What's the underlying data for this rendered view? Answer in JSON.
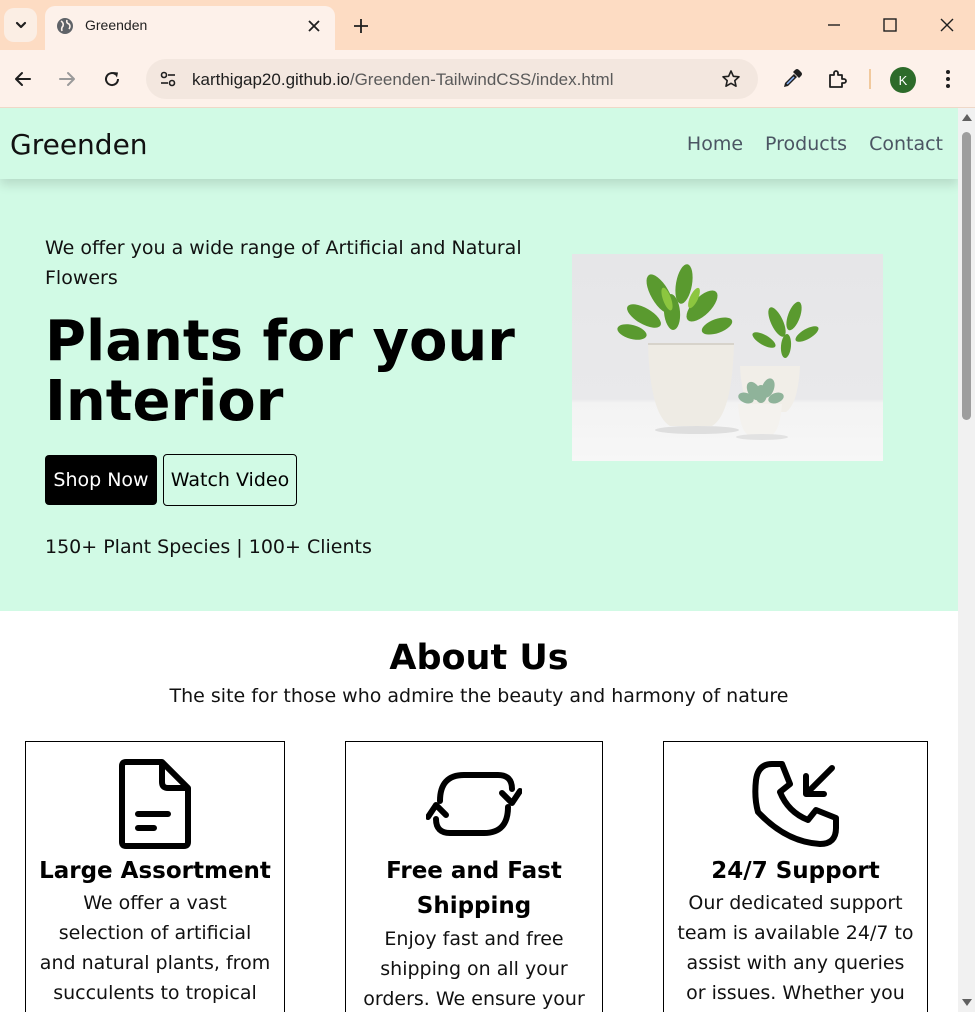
{
  "browser": {
    "tab_title": "Greenden",
    "url_host": "karthigap20.github.io",
    "url_path": "/Greenden-TailwindCSS/index.html",
    "profile_initial": "K",
    "colors": {
      "tabbar": "#fddcc3",
      "toolbar": "#fdf1ea",
      "profile": "#2d6b2a"
    }
  },
  "site": {
    "brand": "Greenden",
    "nav": [
      "Home",
      "Products",
      "Contact"
    ],
    "hero": {
      "subtitle": "We offer you a wide range of Artificial and Natural Flowers",
      "title": "Plants for your Interior",
      "primary_button": "Shop Now",
      "secondary_button": "Watch Video",
      "stats": "150+ Plant Species | 100+ Clients",
      "image_icon": "potted-plants-photo"
    },
    "about": {
      "title": "About Us",
      "subtitle": "The site for those who admire the beauty and harmony of nature",
      "cards": [
        {
          "icon": "document-icon",
          "title": "Large Assortment",
          "text": "We offer a vast selection of artificial and natural plants, from succulents to tropical greens. Whether"
        },
        {
          "icon": "refresh-arrows-icon",
          "title": "Free and Fast Shipping",
          "text": "Enjoy fast and free shipping on all your orders. We ensure your"
        },
        {
          "icon": "phone-incoming-icon",
          "title": "24/7 Support",
          "text": "Our dedicated support team is available 24/7 to assist with any queries or issues. Whether you need"
        }
      ]
    },
    "colors": {
      "hero_bg": "#d1fae5",
      "nav_text": "#4b5563",
      "primary_button": "#000000"
    }
  }
}
